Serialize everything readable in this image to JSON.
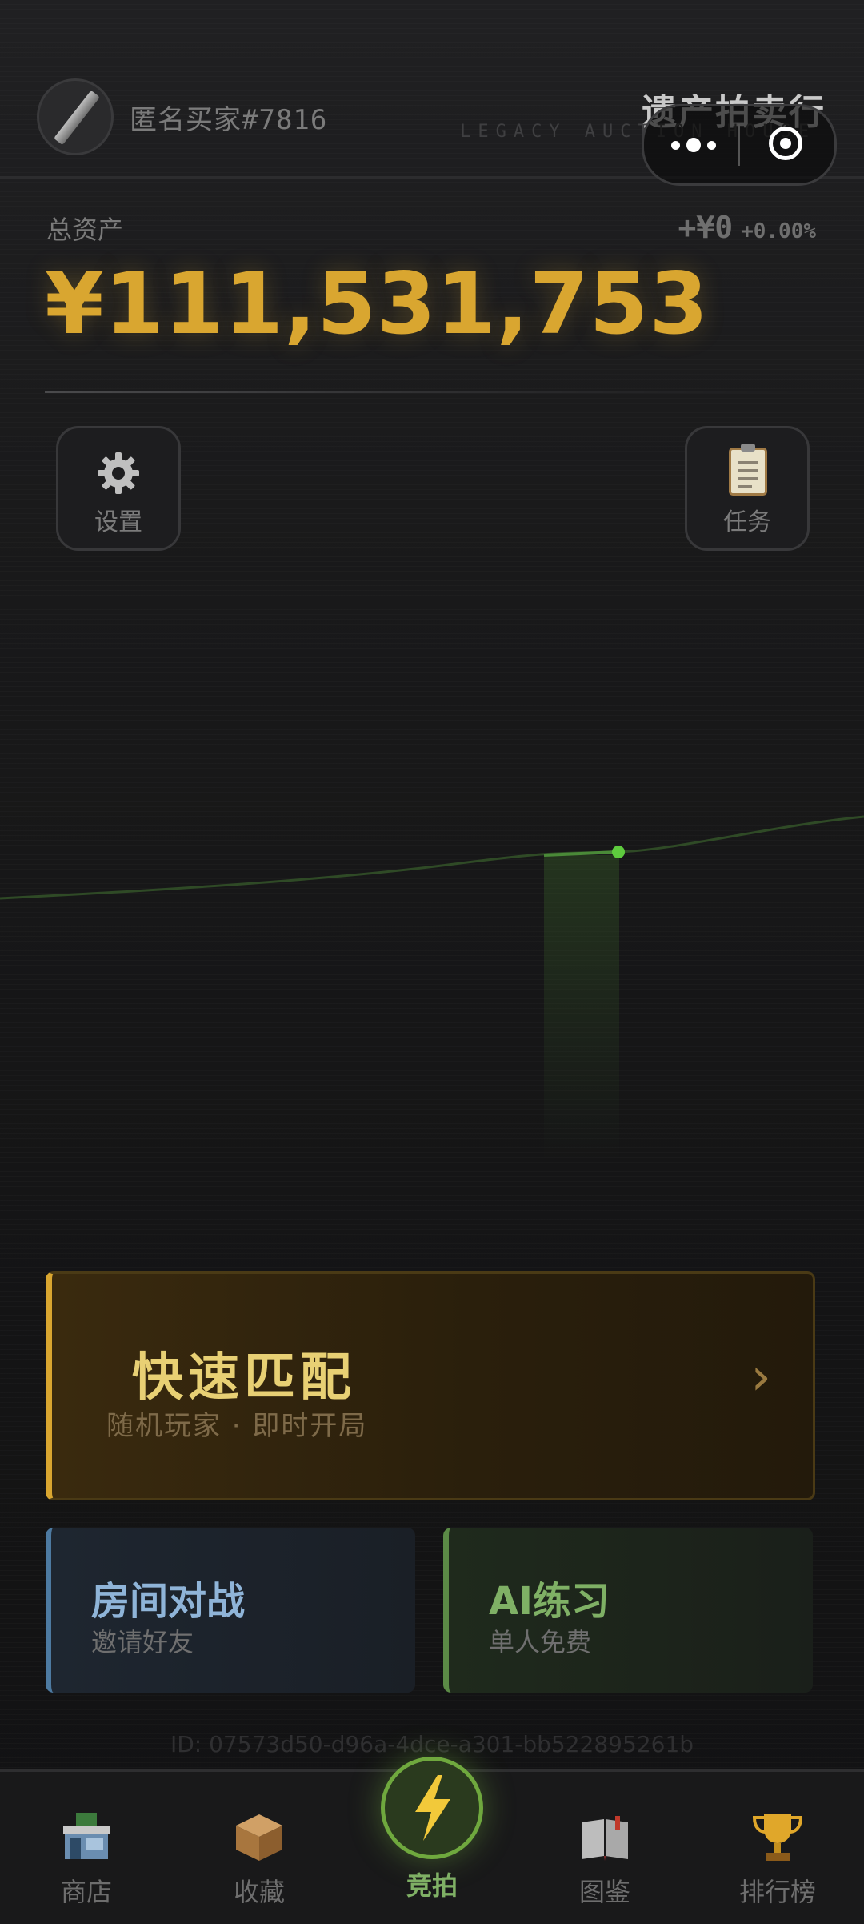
{
  "header": {
    "username": "匿名买家#7816",
    "brand": "遗产拍卖行",
    "brand_sub": "LEGACY AUCTION HOUSE"
  },
  "assets": {
    "label": "总资产",
    "value": "¥111,531,753",
    "change_amount": "+¥0",
    "change_percent": "+0.00%"
  },
  "tiles": {
    "settings": "设置",
    "tasks": "任务"
  },
  "quick_match": {
    "title": "快速匹配",
    "subtitle": "随机玩家 · 即时开局"
  },
  "room_battle": {
    "title": "房间对战",
    "subtitle": "邀请好友"
  },
  "ai_practice": {
    "title": "AI练习",
    "subtitle": "单人免费"
  },
  "user_id": "ID: 07573d50-d96a-4dce-a301-bb522895261b",
  "nav": {
    "shop": "商店",
    "collection": "收藏",
    "auction": "竞拍",
    "codex": "图鉴",
    "leaderboard": "排行榜"
  },
  "colors": {
    "gold": "#d9a630",
    "green": "#6fa83e",
    "blue": "#4d7aa1"
  }
}
